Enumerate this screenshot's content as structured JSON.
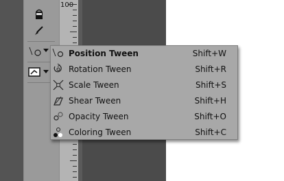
{
  "ruler": {
    "label": "100"
  },
  "menu": {
    "items": [
      {
        "label": "Position Tween",
        "shortcut": "Shift+W",
        "icon": "position-tween-icon",
        "bold": true
      },
      {
        "label": "Rotation Tween",
        "shortcut": "Shift+R",
        "icon": "rotation-tween-icon"
      },
      {
        "label": "Scale Tween",
        "shortcut": "Shift+S",
        "icon": "scale-tween-icon"
      },
      {
        "label": "Shear Tween",
        "shortcut": "Shift+H",
        "icon": "shear-tween-icon"
      },
      {
        "label": "Opacity Tween",
        "shortcut": "Shift+O",
        "icon": "opacity-tween-icon"
      },
      {
        "label": "Coloring Tween",
        "shortcut": "Shift+C",
        "icon": "coloring-tween-icon"
      }
    ]
  },
  "colors": {
    "menu_bg": "#a8a8a8",
    "toolbar_bg": "#9a9a9a",
    "dark_panel": "#4b4b4b"
  }
}
